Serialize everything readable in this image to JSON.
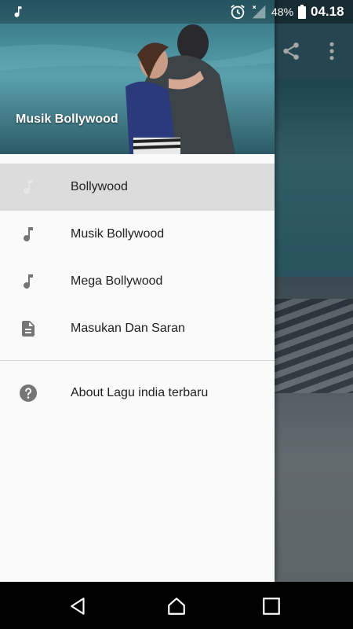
{
  "status_bar": {
    "battery_percent": "48%",
    "time": "04.18",
    "icons": [
      "music-note-icon",
      "alarm-icon",
      "signal-icon",
      "battery-icon"
    ]
  },
  "drawer": {
    "header_title": "Musik Bollywood",
    "items": [
      {
        "label": "Bollywood",
        "icon": "music-note-icon",
        "selected": true
      },
      {
        "label": "Musik Bollywood",
        "icon": "music-note-icon",
        "selected": false
      },
      {
        "label": "Mega Bollywood",
        "icon": "music-note-icon",
        "selected": false
      },
      {
        "label": "Masukan Dan Saran",
        "icon": "document-icon",
        "selected": false
      }
    ],
    "secondary_items": [
      {
        "label": "About Lagu india terbaru",
        "icon": "help-icon"
      }
    ]
  },
  "app_toolbar": {
    "icons": [
      "share-icon",
      "more-vert-icon"
    ]
  },
  "nav_bar": {
    "icons": [
      "back-icon",
      "home-icon",
      "recents-icon"
    ]
  },
  "colors": {
    "drawer_bg": "#fafafa",
    "selected_item_bg": "#dcdcdc",
    "icon_grey": "#757575",
    "header_teal": "#3f8595"
  }
}
